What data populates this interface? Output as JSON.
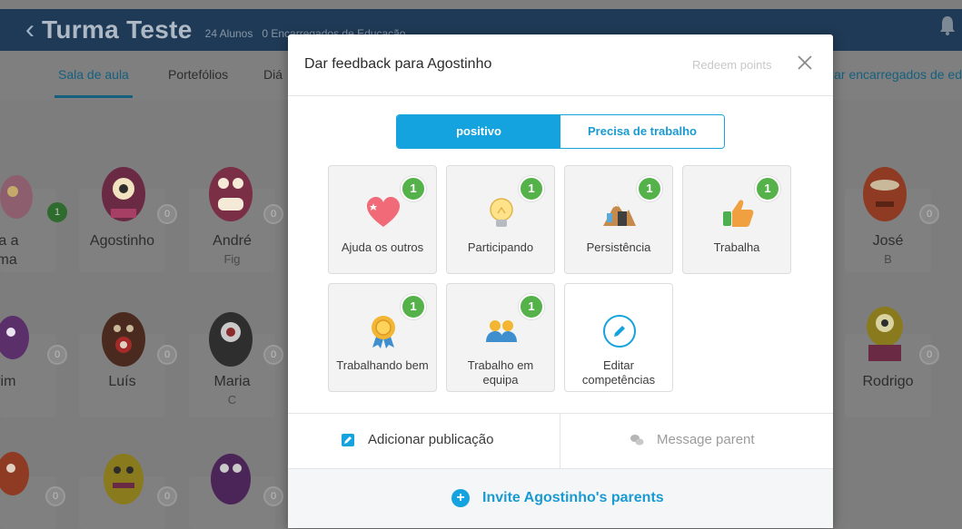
{
  "header": {
    "back_icon": "chevron-left-icon",
    "class_name": "Turma Teste",
    "students_count": "24 Alunos",
    "parents_count": "0 Encarregados de Educação",
    "bell_icon": "bell-icon"
  },
  "tabs": {
    "items": [
      {
        "label": "Sala de aula",
        "active": true
      },
      {
        "label": "Portefólios",
        "active": false
      },
      {
        "label": "Diá",
        "active": false
      }
    ],
    "right_link": "lar encarregados de ed"
  },
  "students": [
    {
      "name": "da a",
      "sub": "rma",
      "points": "1"
    },
    {
      "name": "Agostinho",
      "sub": "",
      "points": "0"
    },
    {
      "name": "André",
      "sub": "Fig",
      "points": "0"
    },
    {
      "name": "José",
      "sub": "B",
      "points": "0"
    },
    {
      "name": "vim",
      "sub": "",
      "points": "0"
    },
    {
      "name": "Luís",
      "sub": "",
      "points": "0"
    },
    {
      "name": "Maria",
      "sub": "C",
      "points": "0"
    },
    {
      "name": "Rodrigo",
      "sub": "",
      "points": "0"
    },
    {
      "name": "",
      "sub": "",
      "points": "0"
    },
    {
      "name": "",
      "sub": "",
      "points": "0"
    },
    {
      "name": "",
      "sub": "",
      "points": "0"
    }
  ],
  "modal": {
    "title": "Dar feedback para Agostinho",
    "redeem_label": "Redeem points",
    "close_icon": "close-icon",
    "toggle": {
      "positive": "positivo",
      "needs_work": "Precisa de trabalho"
    },
    "skills": [
      {
        "label": "Ajuda os outros",
        "points": "1",
        "icon": "heart-icon"
      },
      {
        "label": "Participando",
        "points": "1",
        "icon": "lightbulb-icon"
      },
      {
        "label": "Persistência",
        "points": "1",
        "icon": "mountain-icon"
      },
      {
        "label": "Trabalha",
        "points": "1",
        "icon": "thumbs-up-icon"
      },
      {
        "label": "Trabalhando bem",
        "points": "1",
        "icon": "medal-icon"
      },
      {
        "label": "Trabalho em equipa",
        "points": "1",
        "icon": "team-icon"
      },
      {
        "label": "Editar competências",
        "points": "",
        "icon": "pencil-icon"
      }
    ],
    "actions": {
      "add_post": "Adicionar publicação",
      "message_parent": "Message parent"
    },
    "invite": "Invite Agostinho's parents"
  },
  "colors": {
    "accent": "#14a3de",
    "badge_green": "#55b24a",
    "header_bg": "#1f3a56"
  }
}
